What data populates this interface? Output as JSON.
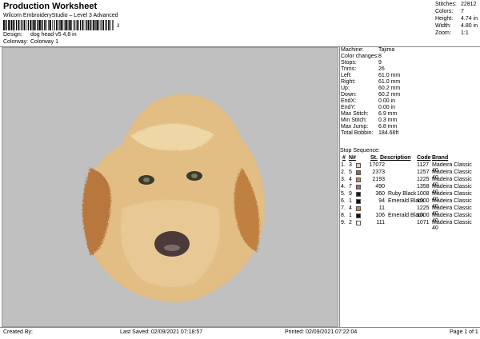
{
  "header": {
    "title": "Production Worksheet",
    "subtitle": "Wilcom EmbroideryStudio – Level 3 Advanced",
    "barcode_suffix": "3",
    "design_label": "Design:",
    "design_value": "dog head v5 4,8 in",
    "colorway_label": "Colorway:",
    "colorway_value": "Colorway 1"
  },
  "stats": [
    {
      "k": "Stitches:",
      "v": "22812"
    },
    {
      "k": "Colors:",
      "v": "7"
    },
    {
      "k": "Height:",
      "v": "4.74 in"
    },
    {
      "k": "Width:",
      "v": "4.80 in"
    },
    {
      "k": "Zoom:",
      "v": "1:1"
    }
  ],
  "machine_info": [
    {
      "k": "Machine:",
      "v": "Tajima"
    },
    {
      "k": "Color changes:",
      "v": "8"
    },
    {
      "k": "Stops:",
      "v": "9"
    },
    {
      "k": "Trims:",
      "v": "26"
    },
    {
      "k": "Left:",
      "v": "61.0 mm"
    },
    {
      "k": "Right:",
      "v": "61.0 mm"
    },
    {
      "k": "Up:",
      "v": "60.2 mm"
    },
    {
      "k": "Down:",
      "v": "60.2 mm"
    },
    {
      "k": "EndX:",
      "v": "0.00 in"
    },
    {
      "k": "EndY:",
      "v": "0.00 in"
    },
    {
      "k": "Max Stitch:",
      "v": "6.9 mm"
    },
    {
      "k": "Min Stitch:",
      "v": "0.3 mm"
    },
    {
      "k": "Max Jump:",
      "v": "6.8 mm"
    },
    {
      "k": "Total Bobbin:",
      "v": "184.66ft"
    }
  ],
  "stop_sequence": {
    "title": "Stop Sequence:",
    "headers": {
      "num": "#",
      "n": "N#",
      "st": "St.",
      "desc": "Description",
      "code": "Code",
      "brand": "Brand"
    },
    "rows": [
      {
        "num": "1.",
        "n": "3",
        "color": "#e8c9a8",
        "st": "17072",
        "desc": "",
        "code": "1127",
        "brand": "Madeira Classic 40"
      },
      {
        "num": "2.",
        "n": "5",
        "color": "#a0613a",
        "st": "2373",
        "desc": "",
        "code": "1257",
        "brand": "Madeira Classic 40"
      },
      {
        "num": "3.",
        "n": "4",
        "color": "#c8894a",
        "st": "2193",
        "desc": "",
        "code": "1225",
        "brand": "Madeira Classic 40"
      },
      {
        "num": "4.",
        "n": "7",
        "color": "#a86a6a",
        "st": "490",
        "desc": "",
        "code": "1358",
        "brand": "Madeira Classic 40"
      },
      {
        "num": "5.",
        "n": "9",
        "color": "#1a1a1a",
        "st": "360",
        "desc": "Ruby Black",
        "code": "1008",
        "brand": "Madeira Classic 40"
      },
      {
        "num": "6.",
        "n": "1",
        "color": "#111111",
        "st": "94",
        "desc": "Emerald Black",
        "code": "1000",
        "brand": "Madeira Classic 40"
      },
      {
        "num": "7.",
        "n": "4",
        "color": "#c8894a",
        "st": "11",
        "desc": "",
        "code": "1225",
        "brand": "Madeira Classic 40"
      },
      {
        "num": "8.",
        "n": "1",
        "color": "#111111",
        "st": "106",
        "desc": "Emerald Black",
        "code": "1000",
        "brand": "Madeira Classic 40"
      },
      {
        "num": "9.",
        "n": "2",
        "color": "#f4f4f4",
        "st": "111",
        "desc": "",
        "code": "1071",
        "brand": "Madeira Classic 40"
      }
    ]
  },
  "footer": {
    "created_by": "Created By:",
    "last_saved": "Last Saved: 02/09/2021 07:18:57",
    "printed": "Printed: 02/09/2021 07:22:04",
    "page": "Page 1 of 1"
  },
  "colors": {
    "preview_bg": "#c0c0c0",
    "fur_light": "#e6c48c",
    "fur_dark": "#c89a5a",
    "ear": "#b8773e",
    "nose": "#4a3a3a"
  }
}
